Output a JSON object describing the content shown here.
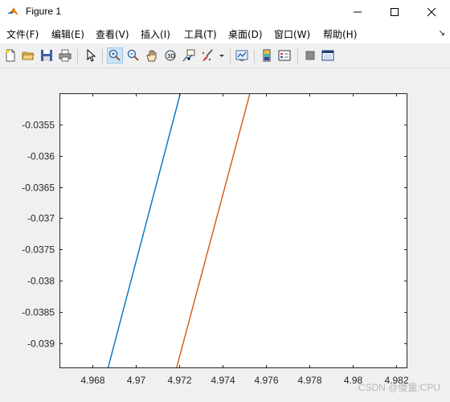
{
  "window": {
    "title": "Figure 1"
  },
  "menu": [
    "文件(F)",
    "编辑(E)",
    "查看(V)",
    "插入(I)",
    "工具(T)",
    "桌面(D)",
    "窗口(W)",
    "帮助(H)"
  ],
  "toolbar": {
    "buttons": [
      "new-figure",
      "open-file",
      "save",
      "print",
      "edit-plot",
      "zoom-in",
      "zoom-out",
      "pan",
      "rotate-3d",
      "data-cursor",
      "brush",
      "link-plot",
      "insert-colorbar",
      "insert-legend",
      "hide-plot-tools",
      "show-plot-tools"
    ]
  },
  "watermark": "CSDN @傻童:CPU",
  "chart_data": {
    "type": "line",
    "title": "",
    "xlabel": "",
    "ylabel": "",
    "xlim": [
      4.9665,
      4.9825
    ],
    "ylim": [
      -0.0394,
      -0.035
    ],
    "grid": false,
    "xticks": [
      4.968,
      4.97,
      4.972,
      4.974,
      4.976,
      4.978,
      4.98,
      4.982
    ],
    "xtick_labels": [
      "4.968",
      "4.97",
      "4.972",
      "4.974",
      "4.976",
      "4.978",
      "4.98",
      "4.982"
    ],
    "yticks": [
      -0.0355,
      -0.036,
      -0.0365,
      -0.037,
      -0.0375,
      -0.038,
      -0.0385,
      -0.039
    ],
    "ytick_labels": [
      "-0.0355",
      "-0.036",
      "-0.0365",
      "-0.037",
      "-0.0375",
      "-0.038",
      "-0.0385",
      "-0.039"
    ],
    "series": [
      {
        "color": "#0072BD",
        "x": [
          4.96873,
          4.97206
        ],
        "y": [
          -0.0394,
          -0.035
        ]
      },
      {
        "color": "#D95319",
        "x": [
          4.97188,
          4.97526
        ],
        "y": [
          -0.0394,
          -0.035
        ]
      }
    ]
  }
}
